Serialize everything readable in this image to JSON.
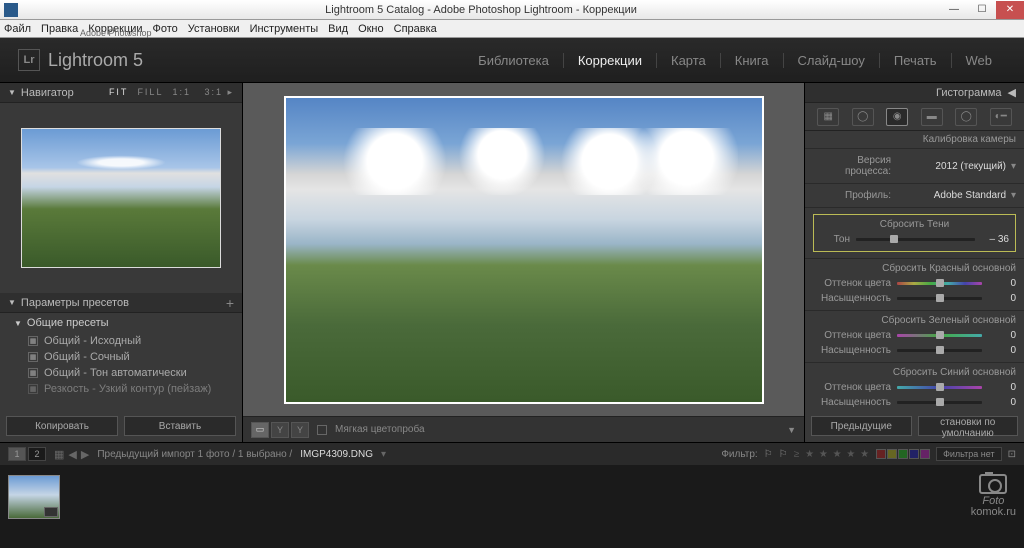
{
  "window": {
    "title": "Lightroom 5 Catalog - Adobe Photoshop Lightroom - Коррекции"
  },
  "menu": [
    "Файл",
    "Правка",
    "Коррекции",
    "Фото",
    "Установки",
    "Инструменты",
    "Вид",
    "Окно",
    "Справка"
  ],
  "app": {
    "brand_sub": "Adobe Photoshop",
    "brand": "Lightroom 5"
  },
  "modules": {
    "items": [
      "Библиотека",
      "Коррекции",
      "Карта",
      "Книга",
      "Слайд-шоу",
      "Печать",
      "Web"
    ],
    "active": "Коррекции"
  },
  "navigator": {
    "title": "Навигатор",
    "zoom_opts": "FIT  FILL  1:1   3:1 ▸",
    "zoom_active": "FIT"
  },
  "presets_panel": {
    "title": "Параметры пресетов",
    "category": "Общие пресеты",
    "items": [
      "Общий - Исходный",
      "Общий - Сочный",
      "Общий - Тон автоматически",
      "Резкость - Узкий контур (пейзаж)"
    ]
  },
  "left_buttons": {
    "copy": "Копировать",
    "paste": "Вставить"
  },
  "center_toolbar": {
    "softproof": "Мягкая цветопроба"
  },
  "right": {
    "histogram": "Гистограмма",
    "calib_header": "Калибровка камеры",
    "process_label": "Версия процесса:",
    "process_value": "2012 (текущий)",
    "profile_label": "Профиль:",
    "profile_value": "Adobe Standard",
    "shadows": {
      "reset": "Сбросить Тени",
      "tone": "Тон",
      "value": "– 36"
    },
    "red": {
      "reset": "Сбросить Красный основной",
      "hue": "Оттенок цвета",
      "hue_v": "0",
      "sat": "Насыщенность",
      "sat_v": "0"
    },
    "green": {
      "reset": "Сбросить Зеленый основной",
      "hue": "Оттенок цвета",
      "hue_v": "0",
      "sat": "Насыщенность",
      "sat_v": "0"
    },
    "blue": {
      "reset": "Сбросить Синий основной",
      "hue": "Оттенок цвета",
      "hue_v": "0",
      "sat": "Насыщенность",
      "sat_v": "0"
    }
  },
  "right_buttons": {
    "prev": "Предыдущие",
    "reset": "становки по умолчанию"
  },
  "filmstrip": {
    "info": "Предыдущий импорт  1 фото /  1 выбрано /",
    "filename": "IMGP4309.DNG",
    "filter_label": "Фильтр:",
    "filter_off": "Фильтра нет"
  },
  "watermark": "komok.ru",
  "watermark_top": "Foto"
}
